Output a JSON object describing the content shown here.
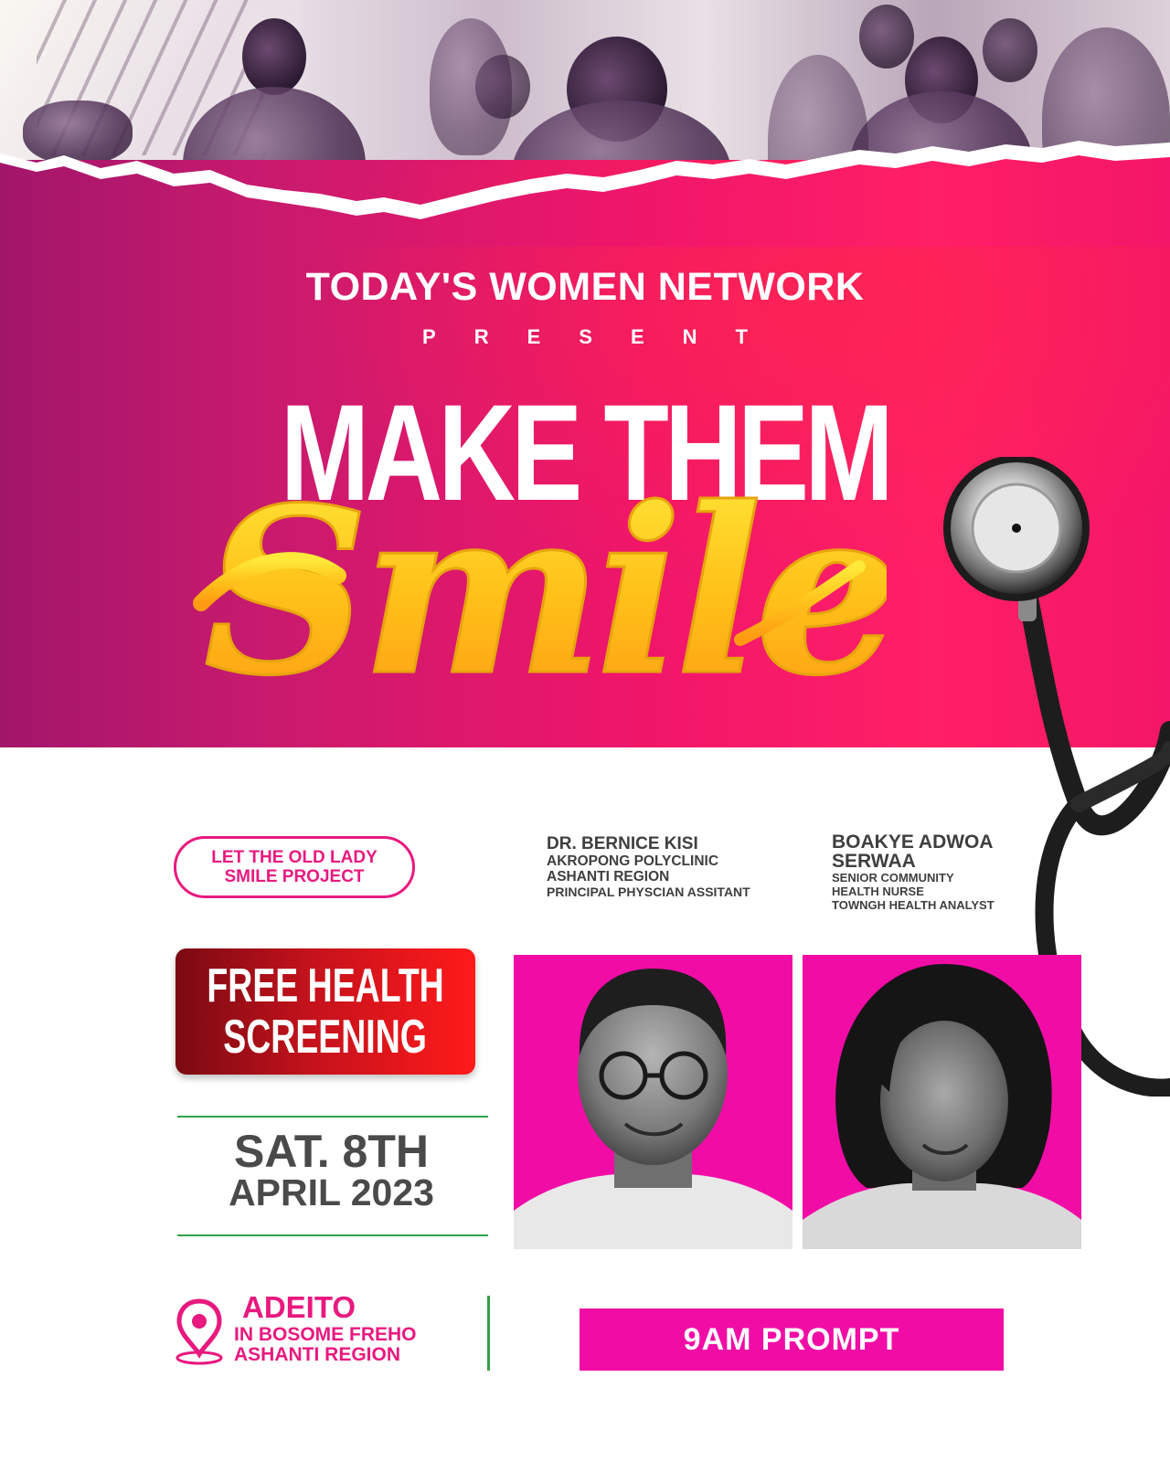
{
  "header": {
    "organization": "TODAY'S WOMEN NETWORK",
    "present_label": "PRESENT"
  },
  "event": {
    "title_main": "MAKE THEM",
    "title_script": "Smile",
    "project_line1": "LET THE OLD LADY",
    "project_line2": "SMILE PROJECT",
    "service_line1": "FREE HEALTH",
    "service_line2": "SCREENING",
    "date_line1": "SAT. 8TH",
    "date_line2": "APRIL 2023",
    "time": "9AM PROMPT"
  },
  "speakers": [
    {
      "name": "DR. BERNICE KISI",
      "lines": [
        "AKROPONG POLYCLINIC",
        "ASHANTI REGION",
        "PRINCIPAL PHYSCIAN ASSITANT"
      ]
    },
    {
      "name_line1": "BOAKYE ADWOA",
      "name_line2": "SERWAA",
      "lines": [
        "SENIOR COMMUNITY",
        "HEALTH NURSE",
        "TOWNGH HEALTH ANALYST"
      ]
    }
  ],
  "venue": {
    "name": "ADEITO",
    "line2": "IN BOSOME FREHO",
    "line3": "ASHANTI REGION"
  },
  "colors": {
    "magenta": "#f20ca6",
    "pink_text": "#e8197f",
    "hero_pink": "#ff1f66",
    "accent_green": "#33a04a",
    "badge_red": "#c4121c",
    "script_yellow": "#ffcc1a"
  },
  "icons": [
    "location-pin-icon",
    "stethoscope-icon"
  ]
}
